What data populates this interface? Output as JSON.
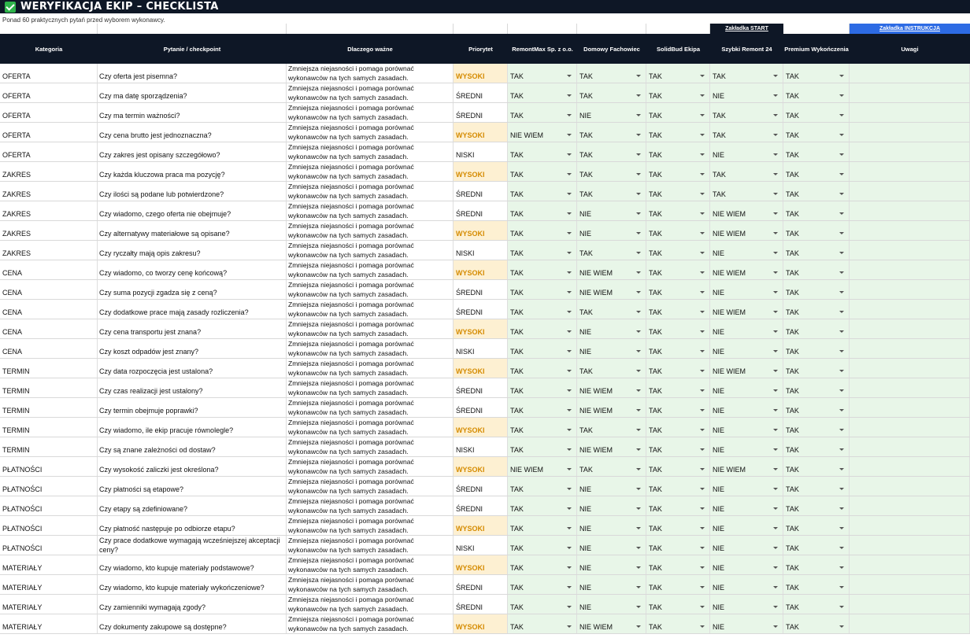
{
  "title": "WERYFIKACJA EKIP – CHECKLISTA",
  "subtitle": "Ponad 60 praktycznych pytań przed wyborem wykonawcy.",
  "links": {
    "start": "Zakładka START",
    "instructions": "Zakładka INSTRUKCJA"
  },
  "headers": {
    "category": "Kategoria",
    "question": "Pytanie / checkpoint",
    "why": "Dlaczego ważne",
    "priority": "Priorytet",
    "contractors": [
      "RemontMax Sp. z o.o.",
      "Domowy Fachowiec",
      "SolidBud Ekipa",
      "Szybki Remont 24",
      "Premium Wykończenia"
    ],
    "notes": "Uwagi"
  },
  "colors": {
    "header_bg": "#0e1726",
    "accent_blue": "#2d6be4",
    "answer_bg": "#e8f6e8",
    "high_bg": "#fdf0d2",
    "high_text": "#d58b00"
  },
  "rows": [
    {
      "cat": "OFERTA",
      "q": "Czy oferta jest pisemna?",
      "why": "Zmniejsza niejasności i pomaga porównać wykonawców na tych samych zasadach.",
      "pri": "WYSOKI",
      "a": [
        "TAK",
        "TAK",
        "TAK",
        "TAK",
        "TAK"
      ]
    },
    {
      "cat": "OFERTA",
      "q": "Czy ma datę sporządzenia?",
      "why": "Zmniejsza niejasności i pomaga porównać wykonawców na tych samych zasadach.",
      "pri": "ŚREDNI",
      "a": [
        "TAK",
        "TAK",
        "TAK",
        "NIE",
        "TAK"
      ]
    },
    {
      "cat": "OFERTA",
      "q": "Czy ma termin ważności?",
      "why": "Zmniejsza niejasności i pomaga porównać wykonawców na tych samych zasadach.",
      "pri": "ŚREDNI",
      "a": [
        "TAK",
        "NIE",
        "TAK",
        "TAK",
        "TAK"
      ]
    },
    {
      "cat": "OFERTA",
      "q": "Czy cena brutto jest jednoznaczna?",
      "why": "Zmniejsza niejasności i pomaga porównać wykonawców na tych samych zasadach.",
      "pri": "WYSOKI",
      "a": [
        "NIE WIEM",
        "TAK",
        "TAK",
        "TAK",
        "TAK"
      ]
    },
    {
      "cat": "OFERTA",
      "q": "Czy zakres jest opisany szczegółowo?",
      "why": "Zmniejsza niejasności i pomaga porównać wykonawców na tych samych zasadach.",
      "pri": "NISKI",
      "a": [
        "TAK",
        "TAK",
        "TAK",
        "NIE",
        "TAK"
      ]
    },
    {
      "cat": "ZAKRES",
      "q": "Czy każda kluczowa praca ma pozycję?",
      "why": "Zmniejsza niejasności i pomaga porównać wykonawców na tych samych zasadach.",
      "pri": "WYSOKI",
      "a": [
        "TAK",
        "TAK",
        "TAK",
        "TAK",
        "TAK"
      ]
    },
    {
      "cat": "ZAKRES",
      "q": "Czy ilości są podane lub potwierdzone?",
      "why": "Zmniejsza niejasności i pomaga porównać wykonawców na tych samych zasadach.",
      "pri": "ŚREDNI",
      "a": [
        "TAK",
        "TAK",
        "TAK",
        "TAK",
        "TAK"
      ]
    },
    {
      "cat": "ZAKRES",
      "q": "Czy wiadomo, czego oferta nie obejmuje?",
      "why": "Zmniejsza niejasności i pomaga porównać wykonawców na tych samych zasadach.",
      "pri": "ŚREDNI",
      "a": [
        "TAK",
        "NIE",
        "TAK",
        "NIE WIEM",
        "TAK"
      ]
    },
    {
      "cat": "ZAKRES",
      "q": "Czy alternatywy materiałowe są opisane?",
      "why": "Zmniejsza niejasności i pomaga porównać wykonawców na tych samych zasadach.",
      "pri": "WYSOKI",
      "a": [
        "TAK",
        "NIE",
        "TAK",
        "NIE WIEM",
        "TAK"
      ]
    },
    {
      "cat": "ZAKRES",
      "q": "Czy ryczałty mają opis zakresu?",
      "why": "Zmniejsza niejasności i pomaga porównać wykonawców na tych samych zasadach.",
      "pri": "NISKI",
      "a": [
        "TAK",
        "TAK",
        "TAK",
        "NIE",
        "TAK"
      ]
    },
    {
      "cat": "CENA",
      "q": "Czy wiadomo, co tworzy cenę końcową?",
      "why": "Zmniejsza niejasności i pomaga porównać wykonawców na tych samych zasadach.",
      "pri": "WYSOKI",
      "a": [
        "TAK",
        "NIE WIEM",
        "TAK",
        "NIE WIEM",
        "TAK"
      ]
    },
    {
      "cat": "CENA",
      "q": "Czy suma pozycji zgadza się z ceną?",
      "why": "Zmniejsza niejasności i pomaga porównać wykonawców na tych samych zasadach.",
      "pri": "ŚREDNI",
      "a": [
        "TAK",
        "NIE WIEM",
        "TAK",
        "NIE",
        "TAK"
      ]
    },
    {
      "cat": "CENA",
      "q": "Czy dodatkowe prace mają zasady rozliczenia?",
      "why": "Zmniejsza niejasności i pomaga porównać wykonawców na tych samych zasadach.",
      "pri": "ŚREDNI",
      "a": [
        "TAK",
        "TAK",
        "TAK",
        "NIE WIEM",
        "TAK"
      ]
    },
    {
      "cat": "CENA",
      "q": "Czy cena transportu jest znana?",
      "why": "Zmniejsza niejasności i pomaga porównać wykonawców na tych samych zasadach.",
      "pri": "WYSOKI",
      "a": [
        "TAK",
        "NIE",
        "TAK",
        "NIE",
        "TAK"
      ]
    },
    {
      "cat": "CENA",
      "q": "Czy koszt odpadów jest znany?",
      "why": "Zmniejsza niejasności i pomaga porównać wykonawców na tych samych zasadach.",
      "pri": "NISKI",
      "a": [
        "TAK",
        "NIE",
        "TAK",
        "NIE",
        "TAK"
      ]
    },
    {
      "cat": "TERMIN",
      "q": "Czy data rozpoczęcia jest ustalona?",
      "why": "Zmniejsza niejasności i pomaga porównać wykonawców na tych samych zasadach.",
      "pri": "WYSOKI",
      "a": [
        "TAK",
        "TAK",
        "TAK",
        "NIE WIEM",
        "TAK"
      ]
    },
    {
      "cat": "TERMIN",
      "q": "Czy czas realizacji jest ustalony?",
      "why": "Zmniejsza niejasności i pomaga porównać wykonawców na tych samych zasadach.",
      "pri": "ŚREDNI",
      "a": [
        "TAK",
        "NIE WIEM",
        "TAK",
        "NIE",
        "TAK"
      ]
    },
    {
      "cat": "TERMIN",
      "q": "Czy termin obejmuje poprawki?",
      "why": "Zmniejsza niejasności i pomaga porównać wykonawców na tych samych zasadach.",
      "pri": "ŚREDNI",
      "a": [
        "TAK",
        "NIE WIEM",
        "TAK",
        "NIE",
        "TAK"
      ]
    },
    {
      "cat": "TERMIN",
      "q": "Czy wiadomo, ile ekip pracuje równolegle?",
      "why": "Zmniejsza niejasności i pomaga porównać wykonawców na tych samych zasadach.",
      "pri": "WYSOKI",
      "a": [
        "TAK",
        "TAK",
        "TAK",
        "NIE",
        "TAK"
      ]
    },
    {
      "cat": "TERMIN",
      "q": "Czy są znane zależności od dostaw?",
      "why": "Zmniejsza niejasności i pomaga porównać wykonawców na tych samych zasadach.",
      "pri": "NISKI",
      "a": [
        "TAK",
        "NIE WIEM",
        "TAK",
        "NIE",
        "TAK"
      ]
    },
    {
      "cat": "PŁATNOŚCI",
      "q": "Czy wysokość zaliczki jest określona?",
      "why": "Zmniejsza niejasności i pomaga porównać wykonawców na tych samych zasadach.",
      "pri": "WYSOKI",
      "a": [
        "NIE WIEM",
        "TAK",
        "TAK",
        "NIE WIEM",
        "TAK"
      ]
    },
    {
      "cat": "PŁATNOŚCI",
      "q": "Czy płatności są etapowe?",
      "why": "Zmniejsza niejasności i pomaga porównać wykonawców na tych samych zasadach.",
      "pri": "ŚREDNI",
      "a": [
        "TAK",
        "NIE",
        "TAK",
        "NIE",
        "TAK"
      ]
    },
    {
      "cat": "PŁATNOŚCI",
      "q": "Czy etapy są zdefiniowane?",
      "why": "Zmniejsza niejasności i pomaga porównać wykonawców na tych samych zasadach.",
      "pri": "ŚREDNI",
      "a": [
        "TAK",
        "NIE",
        "TAK",
        "NIE",
        "TAK"
      ]
    },
    {
      "cat": "PŁATNOŚCI",
      "q": "Czy płatność następuje po odbiorze etapu?",
      "why": "Zmniejsza niejasności i pomaga porównać wykonawców na tych samych zasadach.",
      "pri": "WYSOKI",
      "a": [
        "TAK",
        "NIE",
        "TAK",
        "NIE",
        "TAK"
      ]
    },
    {
      "cat": "PŁATNOŚCI",
      "q": "Czy prace dodatkowe wymagają wcześniejszej akceptacji ceny?",
      "why": "Zmniejsza niejasności i pomaga porównać wykonawców na tych samych zasadach.",
      "pri": "NISKI",
      "a": [
        "TAK",
        "NIE",
        "TAK",
        "NIE",
        "TAK"
      ]
    },
    {
      "cat": "MATERIAŁY",
      "q": "Czy wiadomo, kto kupuje materiały podstawowe?",
      "why": "Zmniejsza niejasności i pomaga porównać wykonawców na tych samych zasadach.",
      "pri": "WYSOKI",
      "a": [
        "TAK",
        "NIE",
        "TAK",
        "NIE",
        "TAK"
      ]
    },
    {
      "cat": "MATERIAŁY",
      "q": "Czy wiadomo, kto kupuje materiały wykończeniowe?",
      "why": "Zmniejsza niejasności i pomaga porównać wykonawców na tych samych zasadach.",
      "pri": "ŚREDNI",
      "a": [
        "TAK",
        "NIE",
        "TAK",
        "NIE",
        "TAK"
      ]
    },
    {
      "cat": "MATERIAŁY",
      "q": "Czy zamienniki wymagają zgody?",
      "why": "Zmniejsza niejasności i pomaga porównać wykonawców na tych samych zasadach.",
      "pri": "ŚREDNI",
      "a": [
        "TAK",
        "NIE",
        "TAK",
        "NIE",
        "TAK"
      ]
    },
    {
      "cat": "MATERIAŁY",
      "q": "Czy dokumenty zakupowe są dostępne?",
      "why": "Zmniejsza niejasności i pomaga porównać wykonawców na tych samych zasadach.",
      "pri": "WYSOKI",
      "a": [
        "TAK",
        "NIE WIEM",
        "TAK",
        "NIE",
        "TAK"
      ]
    }
  ]
}
